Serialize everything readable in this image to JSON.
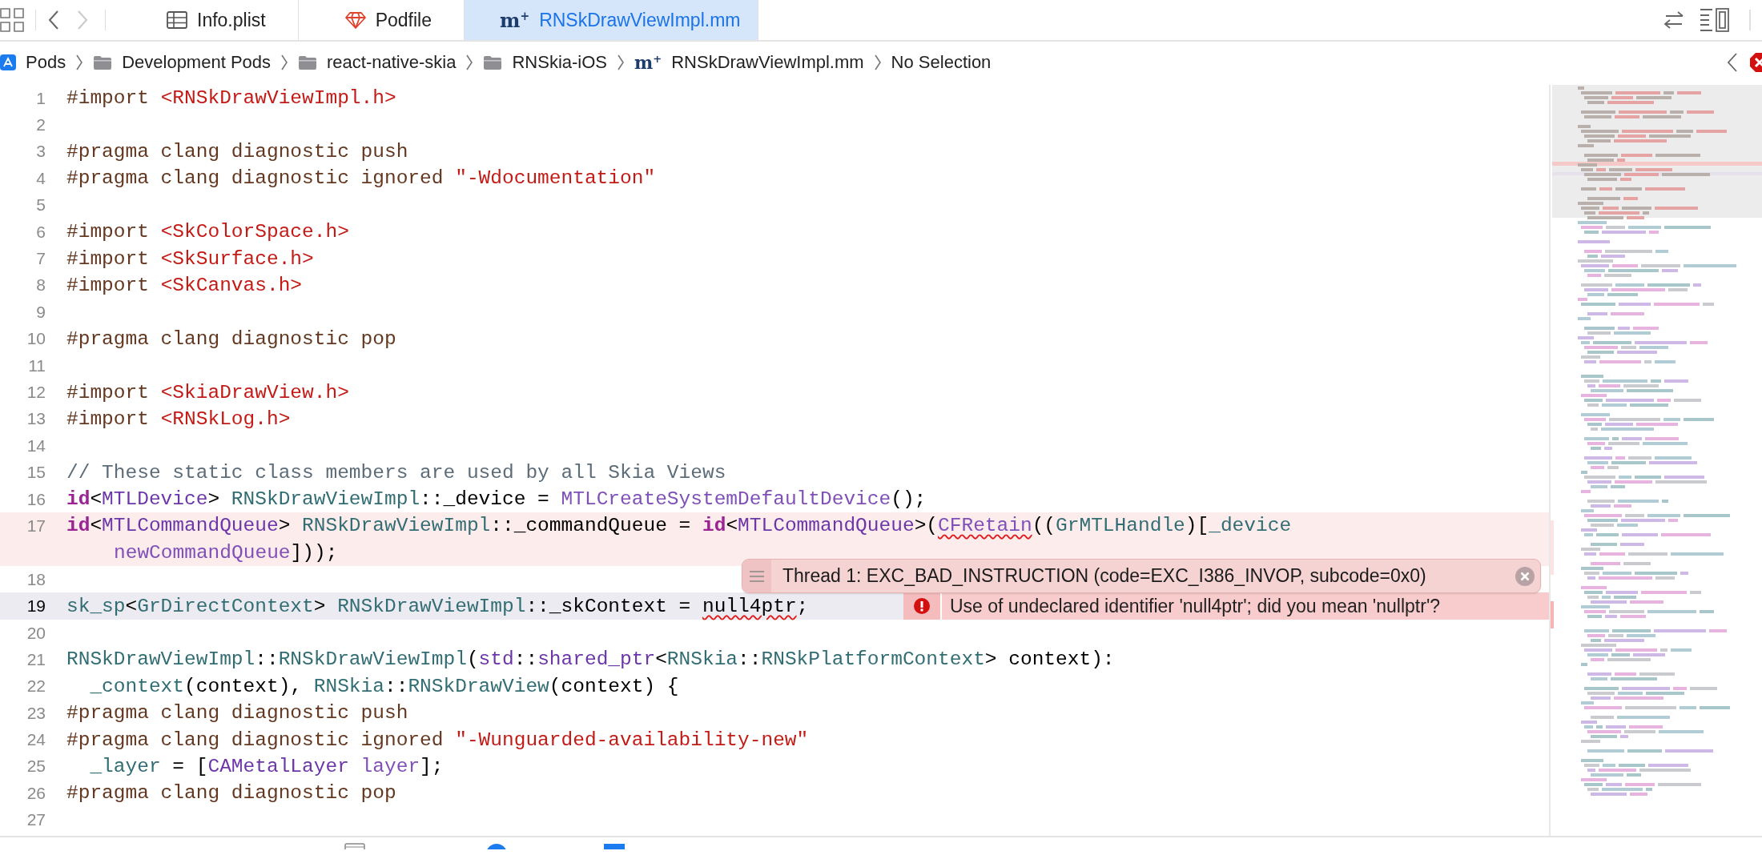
{
  "nav": {
    "back_enabled": true,
    "forward_enabled": false
  },
  "tabs": [
    {
      "label": "Info.plist",
      "kind": "table",
      "selected": false
    },
    {
      "label": "Podfile",
      "kind": "gem",
      "selected": false
    },
    {
      "label": "RNSkDrawViewImpl.mm",
      "kind": "glyph",
      "glyph": "m$^{+}$",
      "selected": true
    }
  ],
  "breadcrumb": [
    {
      "label": "Pods",
      "kind": "project"
    },
    {
      "label": "Development Pods",
      "kind": "folder"
    },
    {
      "label": "react-native-skia",
      "kind": "folder"
    },
    {
      "label": "RNSkia-iOS",
      "kind": "folder"
    },
    {
      "label": "RNSkDrawViewImpl.mm",
      "kind": "glyph",
      "glyph": "m$^{+}$"
    },
    {
      "label": "No Selection",
      "kind": "plain"
    }
  ],
  "lines": [
    {
      "number": "1",
      "kind": "plain",
      "tokens": [
        {
          "text": "#import ",
          "kind": "directive"
        },
        {
          "text": "<RNSkDrawViewImpl.h>",
          "kind": "string"
        }
      ]
    },
    {
      "number": "2",
      "kind": "plain"
    },
    {
      "number": "3",
      "kind": "plain",
      "tokens": [
        {
          "text": "#pragma clang diagnostic push",
          "kind": "directive"
        }
      ]
    },
    {
      "number": "4",
      "kind": "plain",
      "tokens": [
        {
          "text": "#pragma clang diagnostic ignored ",
          "kind": "directive"
        },
        {
          "text": "\"-Wdocumentation\"",
          "kind": "string"
        }
      ]
    },
    {
      "number": "5",
      "kind": "plain"
    },
    {
      "number": "6",
      "kind": "plain",
      "tokens": [
        {
          "text": "#import ",
          "kind": "directive"
        },
        {
          "text": "<SkColorSpace.h>",
          "kind": "string"
        }
      ]
    },
    {
      "number": "7",
      "kind": "plain",
      "tokens": [
        {
          "text": "#import ",
          "kind": "directive"
        },
        {
          "text": "<SkSurface.h>",
          "kind": "string"
        }
      ]
    },
    {
      "number": "8",
      "kind": "plain",
      "tokens": [
        {
          "text": "#import ",
          "kind": "directive"
        },
        {
          "text": "<SkCanvas.h>",
          "kind": "string"
        }
      ]
    },
    {
      "number": "9",
      "kind": "plain"
    },
    {
      "number": "10",
      "kind": "plain",
      "tokens": [
        {
          "text": "#pragma clang diagnostic pop",
          "kind": "directive"
        }
      ]
    },
    {
      "number": "11",
      "kind": "plain"
    },
    {
      "number": "12",
      "kind": "plain",
      "tokens": [
        {
          "text": "#import ",
          "kind": "directive"
        },
        {
          "text": "<SkiaDrawView.h>",
          "kind": "string"
        }
      ]
    },
    {
      "number": "13",
      "kind": "plain",
      "tokens": [
        {
          "text": "#import ",
          "kind": "directive"
        },
        {
          "text": "<RNSkLog.h>",
          "kind": "string"
        }
      ]
    },
    {
      "number": "14",
      "kind": "plain"
    },
    {
      "number": "15",
      "kind": "plain",
      "tokens": [
        {
          "text": "// These static class members are used by all Skia Views",
          "kind": "comment"
        }
      ]
    },
    {
      "number": "16",
      "kind": "plain",
      "tokens": [
        {
          "text": "id",
          "kind": "keyword"
        },
        {
          "text": "<",
          "kind": "plain"
        },
        {
          "text": "MTLDevice",
          "kind": "sys"
        },
        {
          "text": "> ",
          "kind": "plain"
        },
        {
          "text": "RNSkDrawViewImpl",
          "kind": "proj"
        },
        {
          "text": "::_device = ",
          "kind": "plain"
        },
        {
          "text": "MTLCreateSystemDefaultDevice",
          "kind": "sysfn"
        },
        {
          "text": "();",
          "kind": "plain"
        }
      ]
    },
    {
      "number": "17",
      "kind": "error",
      "tokens": [
        {
          "text": "id",
          "kind": "keyword"
        },
        {
          "text": "<",
          "kind": "plain"
        },
        {
          "text": "MTLCommandQueue",
          "kind": "sys"
        },
        {
          "text": "> ",
          "kind": "plain"
        },
        {
          "text": "RNSkDrawViewImpl",
          "kind": "proj"
        },
        {
          "text": "::_commandQueue = ",
          "kind": "plain"
        },
        {
          "text": "id",
          "kind": "keyword"
        },
        {
          "text": "<",
          "kind": "plain"
        },
        {
          "text": "MTLCommandQueue",
          "kind": "sys"
        },
        {
          "text": ">(",
          "kind": "plain"
        },
        {
          "text": "CFRetain",
          "kind": "sysfn-flagged"
        },
        {
          "text": "((",
          "kind": "plain"
        },
        {
          "text": "GrMTLHandle",
          "kind": "proj"
        },
        {
          "text": ")[",
          "kind": "plain"
        },
        {
          "text": "_device",
          "kind": "proj"
        }
      ],
      "wrapped_tokens": [
        {
          "text": "newCommandQueue",
          "kind": "sysfn"
        },
        {
          "text": "]));",
          "kind": "plain"
        }
      ]
    },
    {
      "number": "18",
      "kind": "plain"
    },
    {
      "number": "19",
      "kind": "current",
      "tokens": [
        {
          "text": "sk_sp",
          "kind": "proj"
        },
        {
          "text": "<",
          "kind": "plain"
        },
        {
          "text": "GrDirectContext",
          "kind": "proj"
        },
        {
          "text": "> ",
          "kind": "plain"
        },
        {
          "text": "RNSkDrawViewImpl",
          "kind": "proj"
        },
        {
          "text": "::_skContext = ",
          "kind": "plain"
        },
        {
          "text": "null4ptr",
          "kind": "plain-flagged"
        },
        {
          "text": ";",
          "kind": "plain"
        }
      ],
      "annotation": {
        "kind": "error",
        "text": "Use of undeclared identifier 'null4ptr'; did you mean 'nullptr'?"
      }
    },
    {
      "number": "20",
      "kind": "plain"
    },
    {
      "number": "21",
      "kind": "plain",
      "tokens": [
        {
          "text": "RNSkDrawViewImpl",
          "kind": "proj"
        },
        {
          "text": "::",
          "kind": "plain"
        },
        {
          "text": "RNSkDrawViewImpl",
          "kind": "proj"
        },
        {
          "text": "(",
          "kind": "plain"
        },
        {
          "text": "std",
          "kind": "sys"
        },
        {
          "text": "::",
          "kind": "plain"
        },
        {
          "text": "shared_ptr",
          "kind": "sys"
        },
        {
          "text": "<",
          "kind": "plain"
        },
        {
          "text": "RNSkia",
          "kind": "proj"
        },
        {
          "text": "::",
          "kind": "plain"
        },
        {
          "text": "RNSkPlatformContext",
          "kind": "proj"
        },
        {
          "text": "> context):",
          "kind": "plain"
        }
      ]
    },
    {
      "number": "22",
      "kind": "plain",
      "tokens": [
        {
          "text": "  _context",
          "kind": "proj"
        },
        {
          "text": "(context), ",
          "kind": "plain"
        },
        {
          "text": "RNSkia",
          "kind": "proj"
        },
        {
          "text": "::",
          "kind": "plain"
        },
        {
          "text": "RNSkDrawView",
          "kind": "proj"
        },
        {
          "text": "(context) {",
          "kind": "plain"
        }
      ]
    },
    {
      "number": "23",
      "kind": "plain",
      "tokens": [
        {
          "text": "#pragma clang diagnostic push",
          "kind": "directive"
        }
      ]
    },
    {
      "number": "24",
      "kind": "plain",
      "tokens": [
        {
          "text": "#pragma clang diagnostic ignored ",
          "kind": "directive"
        },
        {
          "text": "\"-Wunguarded-availability-new\"",
          "kind": "string"
        }
      ]
    },
    {
      "number": "25",
      "kind": "plain",
      "tokens": [
        {
          "text": "  _layer",
          "kind": "proj"
        },
        {
          "text": " = [",
          "kind": "plain"
        },
        {
          "text": "CAMetalLayer",
          "kind": "sys"
        },
        {
          "text": " layer",
          "kind": "sysfn"
        },
        {
          "text": "];",
          "kind": "plain"
        }
      ]
    },
    {
      "number": "26",
      "kind": "plain",
      "tokens": [
        {
          "text": "#pragma clang diagnostic pop",
          "kind": "directive"
        }
      ]
    },
    {
      "number": "27",
      "kind": "plain"
    }
  ],
  "thread_banner": {
    "text": "Thread 1: EXC_BAD_INSTRUCTION (code=EXC_I386_INVOP, subcode=0x0)"
  }
}
